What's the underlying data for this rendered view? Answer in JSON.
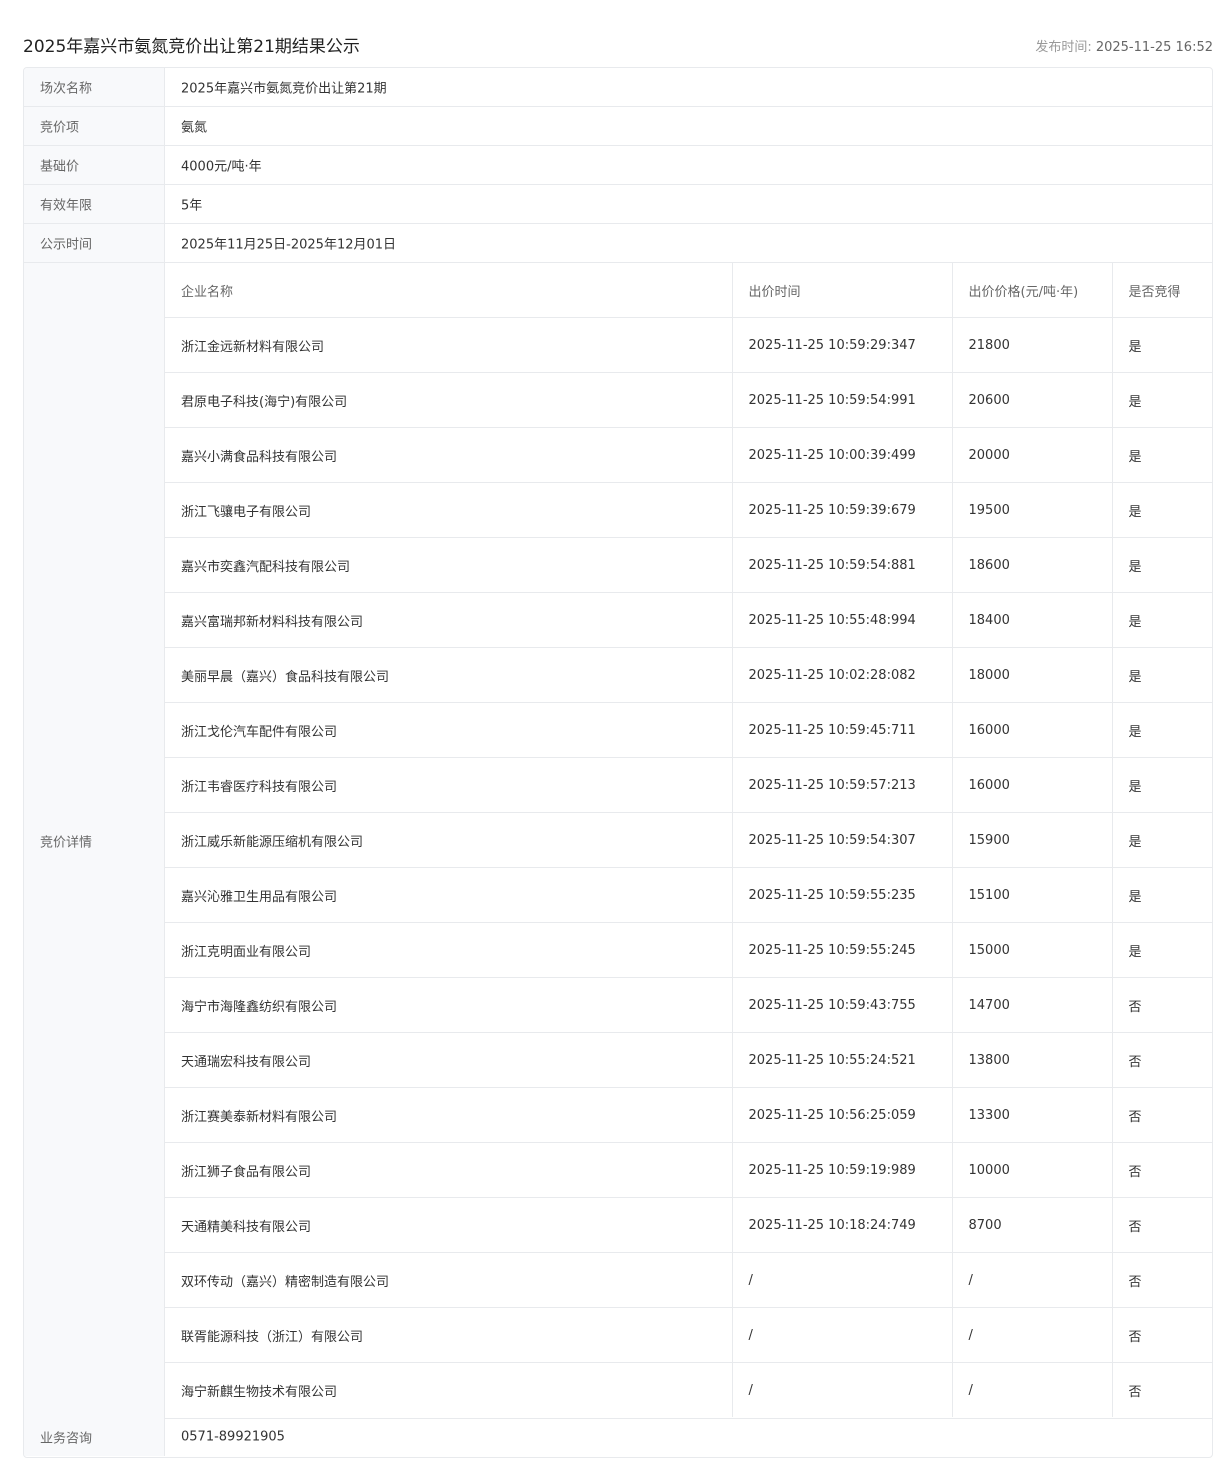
{
  "page": {
    "title": "2025年嘉兴市氨氮竞价出让第21期结果公示",
    "publish_label": "发布时间: ",
    "publish_time": "2025-11-25 16:52"
  },
  "info": {
    "session_name_label": "场次名称",
    "session_name": "2025年嘉兴市氨氮竞价出让第21期",
    "item_label": "竞价项",
    "item": "氨氮",
    "base_price_label": "基础价",
    "base_price": "4000元/吨·年",
    "validity_label": "有效年限",
    "validity": "5年",
    "notice_period_label": "公示时间",
    "notice_period": "2025年11月25日-2025年12月01日",
    "detail_label": "竞价详情",
    "contact_label": "业务咨询",
    "contact": "0571-89921905"
  },
  "bids": {
    "headers": [
      "企业名称",
      "出价时间",
      "出价价格(元/吨·年)",
      "是否竞得"
    ],
    "rows": [
      [
        "浙江金远新材料有限公司",
        "2025-11-25 10:59:29:347",
        "21800",
        "是"
      ],
      [
        "君原电子科技(海宁)有限公司",
        "2025-11-25 10:59:54:991",
        "20600",
        "是"
      ],
      [
        "嘉兴小满食品科技有限公司",
        "2025-11-25 10:00:39:499",
        "20000",
        "是"
      ],
      [
        "浙江飞骧电子有限公司",
        "2025-11-25 10:59:39:679",
        "19500",
        "是"
      ],
      [
        "嘉兴市奕鑫汽配科技有限公司",
        "2025-11-25 10:59:54:881",
        "18600",
        "是"
      ],
      [
        "嘉兴富瑞邦新材料科技有限公司",
        "2025-11-25 10:55:48:994",
        "18400",
        "是"
      ],
      [
        "美丽早晨（嘉兴）食品科技有限公司",
        "2025-11-25 10:02:28:082",
        "18000",
        "是"
      ],
      [
        "浙江戈伦汽车配件有限公司",
        "2025-11-25 10:59:45:711",
        "16000",
        "是"
      ],
      [
        "浙江韦睿医疗科技有限公司",
        "2025-11-25 10:59:57:213",
        "16000",
        "是"
      ],
      [
        "浙江威乐新能源压缩机有限公司",
        "2025-11-25 10:59:54:307",
        "15900",
        "是"
      ],
      [
        "嘉兴沁雅卫生用品有限公司",
        "2025-11-25 10:59:55:235",
        "15100",
        "是"
      ],
      [
        "浙江克明面业有限公司",
        "2025-11-25 10:59:55:245",
        "15000",
        "是"
      ],
      [
        "海宁市海隆鑫纺织有限公司",
        "2025-11-25 10:59:43:755",
        "14700",
        "否"
      ],
      [
        "天通瑞宏科技有限公司",
        "2025-11-25 10:55:24:521",
        "13800",
        "否"
      ],
      [
        "浙江赛美泰新材料有限公司",
        "2025-11-25 10:56:25:059",
        "13300",
        "否"
      ],
      [
        "浙江狮子食品有限公司",
        "2025-11-25 10:59:19:989",
        "10000",
        "否"
      ],
      [
        "天通精美科技有限公司",
        "2025-11-25 10:18:24:749",
        "8700",
        "否"
      ],
      [
        "双环传动（嘉兴）精密制造有限公司",
        "/",
        "/",
        "否"
      ],
      [
        "联胥能源科技（浙江）有限公司",
        "/",
        "/",
        "否"
      ],
      [
        "海宁新麒生物技术有限公司",
        "/",
        "/",
        "否"
      ]
    ]
  }
}
